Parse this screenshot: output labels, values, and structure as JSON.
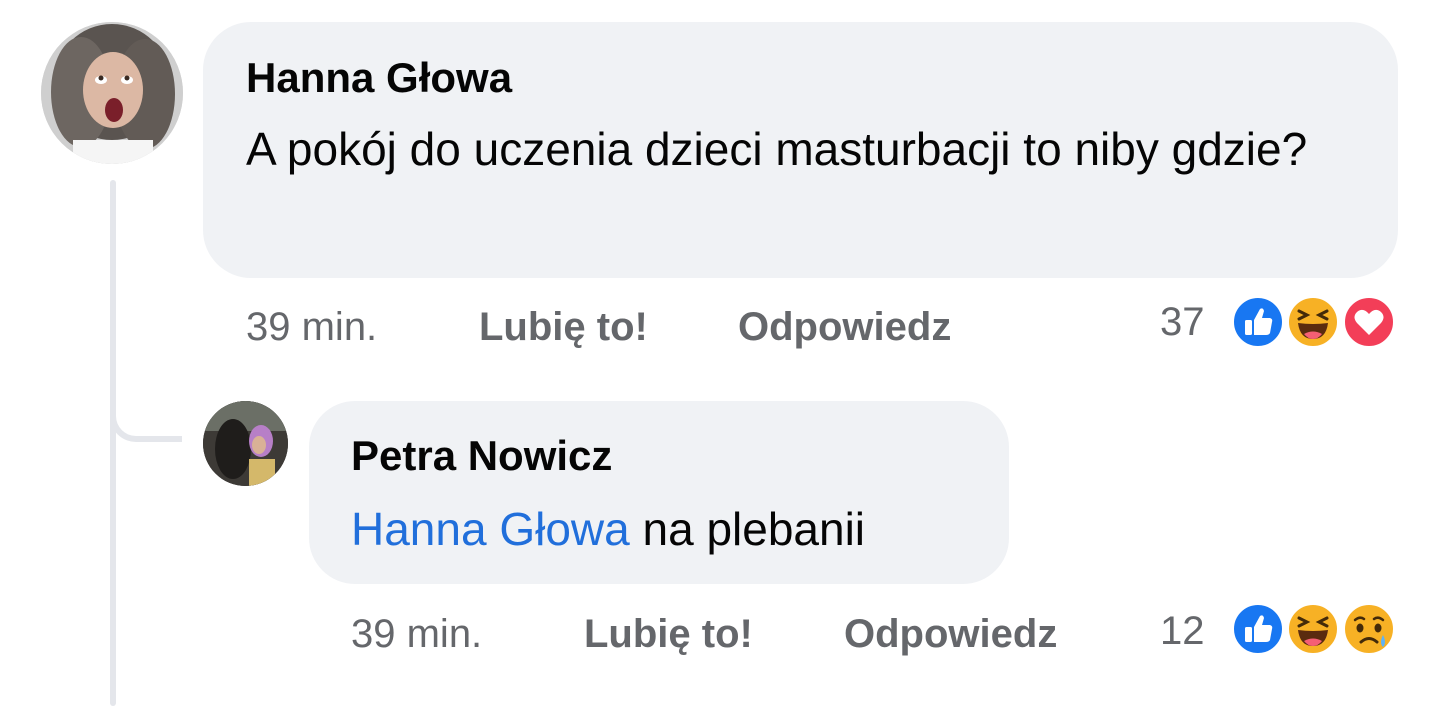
{
  "comments": [
    {
      "author": "Hanna Głowa",
      "text": "A pokój do uczenia dzieci masturbacji to niby gdzie?",
      "time": "39 min.",
      "like_label": "Lubię to!",
      "reply_label": "Odpowiedz",
      "reaction_count": "37",
      "reactions": [
        "like-icon",
        "haha-icon",
        "love-icon"
      ]
    },
    {
      "author": "Petra Nowicz",
      "mention": "Hanna Głowa",
      "text": " na plebanii",
      "time": "39 min.",
      "like_label": "Lubię to!",
      "reply_label": "Odpowiedz",
      "reaction_count": "12",
      "reactions": [
        "like-icon",
        "haha-icon",
        "sad-icon"
      ]
    }
  ],
  "colors": {
    "bubble": "#f0f2f5",
    "meta": "#65676b",
    "mention": "#216fdb",
    "like": "#1877f2",
    "love": "#f33e58",
    "haha": "#f7b125"
  }
}
